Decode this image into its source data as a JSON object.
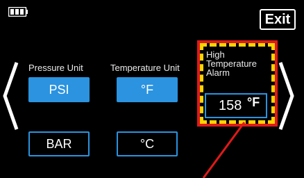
{
  "header": {
    "exit_label": "Exit",
    "battery_icon": "battery-icon"
  },
  "nav": {
    "prev_icon": "chevron-left-icon",
    "next_icon": "chevron-right-icon"
  },
  "pressure": {
    "label": "Pressure Unit",
    "options": [
      "PSI",
      "BAR"
    ],
    "selected": "PSI"
  },
  "temperature": {
    "label": "Temperature Unit",
    "options": [
      "°F",
      "°C"
    ],
    "selected": "°F"
  },
  "alarm": {
    "label_lines": [
      "High",
      "Temperature",
      "Alarm"
    ],
    "value": "158",
    "unit": "°F"
  },
  "colors": {
    "background": "#000000",
    "accent": "#2b93df",
    "highlight_red": "#e01919",
    "highlight_yellow": "#ffd400"
  }
}
